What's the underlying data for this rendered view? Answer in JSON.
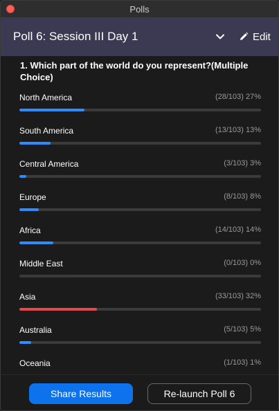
{
  "window": {
    "title": "Polls"
  },
  "header": {
    "poll_title": "Poll 6: Session III Day 1",
    "edit_label": "Edit"
  },
  "question": {
    "text": "1. Which part of the world do you represent?(Multiple Choice)"
  },
  "answers": [
    {
      "label": "North America",
      "stats": "(28/103) 27%",
      "percent": 27
    },
    {
      "label": "South America",
      "stats": "(13/103) 13%",
      "percent": 13
    },
    {
      "label": "Central America",
      "stats": "(3/103) 3%",
      "percent": 3
    },
    {
      "label": "Europe",
      "stats": "(8/103) 8%",
      "percent": 8
    },
    {
      "label": "Africa",
      "stats": "(14/103) 14%",
      "percent": 14
    },
    {
      "label": "Middle East",
      "stats": "(0/103) 0%",
      "percent": 0
    },
    {
      "label": "Asia",
      "stats": "(33/103) 32%",
      "percent": 32
    },
    {
      "label": "Australia",
      "stats": "(5/103) 5%",
      "percent": 5
    },
    {
      "label": "Oceania",
      "stats": "(1/103) 1%",
      "percent": 1
    }
  ],
  "footer": {
    "share_label": "Share Results",
    "relaunch_label": "Re-launch Poll 6"
  },
  "colors": {
    "accent": "#2d8cff",
    "highlight": "#e8474c",
    "header_bg": "#3b3a52",
    "primary_button": "#0e72ed"
  },
  "icons": {
    "close": "close-dot-icon",
    "dropdown": "chevron-down-icon",
    "edit": "pencil-icon"
  }
}
